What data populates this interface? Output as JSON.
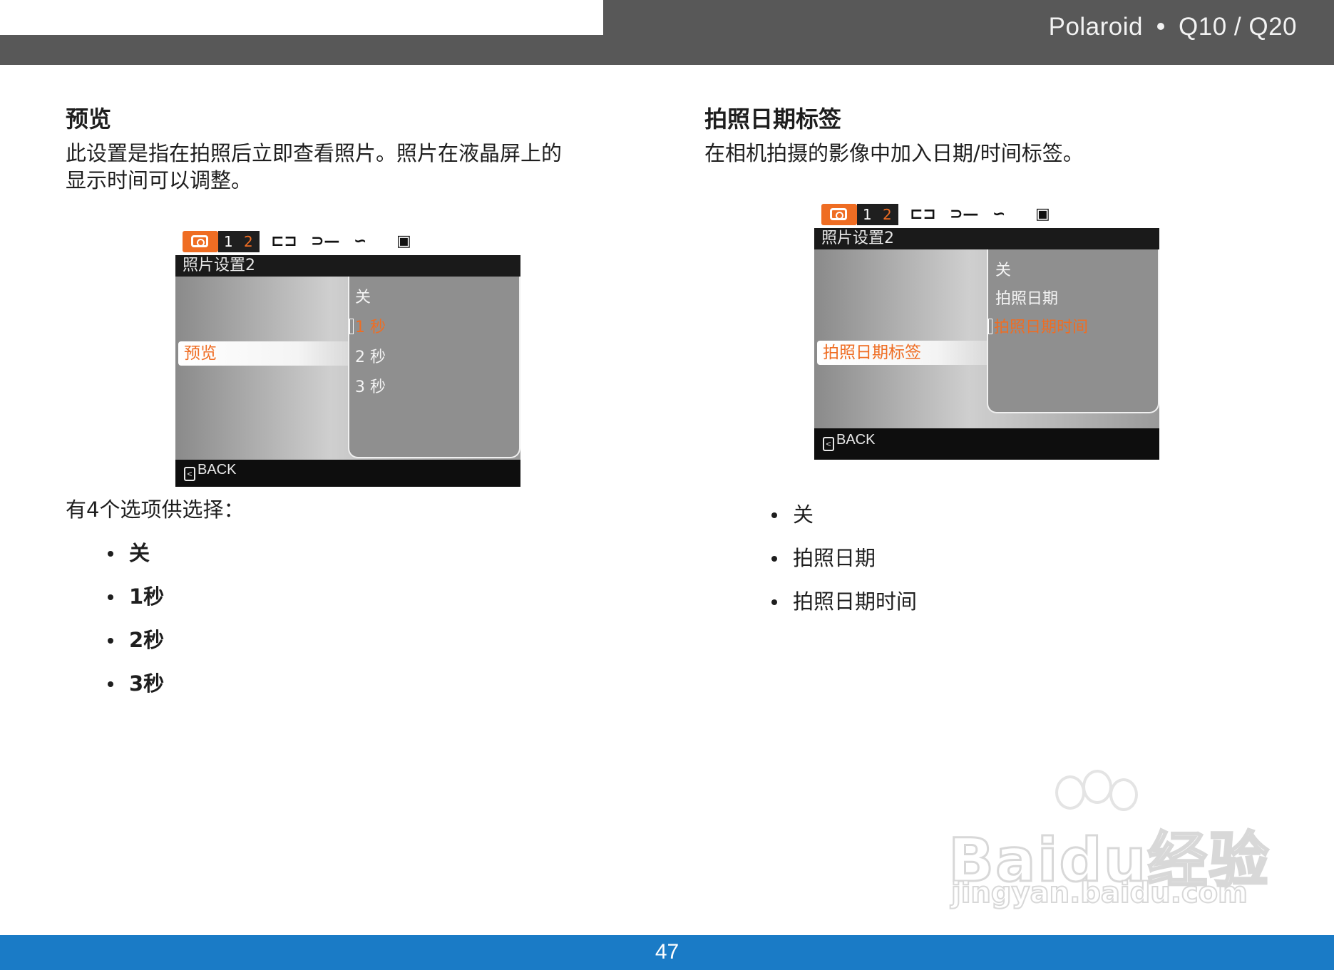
{
  "header": {
    "brand": "Polaroid",
    "model": "Q10 / Q20"
  },
  "left": {
    "title": "预览",
    "desc_line1": "此设置是指在拍照后立即查看照片。照片在液晶屏上的",
    "desc_line2": "显示时间可以调整。",
    "screen": {
      "tab1": "1",
      "tab2": "2",
      "menu_title": "照片设置2",
      "selected_item": "预览",
      "options": [
        "关",
        "1 秒",
        "2 秒",
        "3 秒"
      ],
      "back": "BACK"
    },
    "choices_intro": "有4个选项供选择：",
    "choices": [
      "关",
      "1秒",
      "2秒",
      "3秒"
    ]
  },
  "right": {
    "title": "拍照日期标签",
    "desc": "在相机拍摄的影像中加入日期/时间标签。",
    "screen": {
      "tab1": "1",
      "tab2": "2",
      "menu_title": "照片设置2",
      "selected_item": "拍照日期标签",
      "options": [
        "关",
        "拍照日期",
        "拍照日期时间"
      ],
      "back": "BACK"
    },
    "choices": [
      "关",
      "拍照日期",
      "拍照日期时间"
    ]
  },
  "watermark": {
    "main": "Baidu经验",
    "sub": "jingyan.baidu.com"
  },
  "footer": {
    "page_number": "47"
  },
  "colors": {
    "accent": "#ef6d23",
    "footer": "#1a7bc6",
    "header": "#585858"
  }
}
